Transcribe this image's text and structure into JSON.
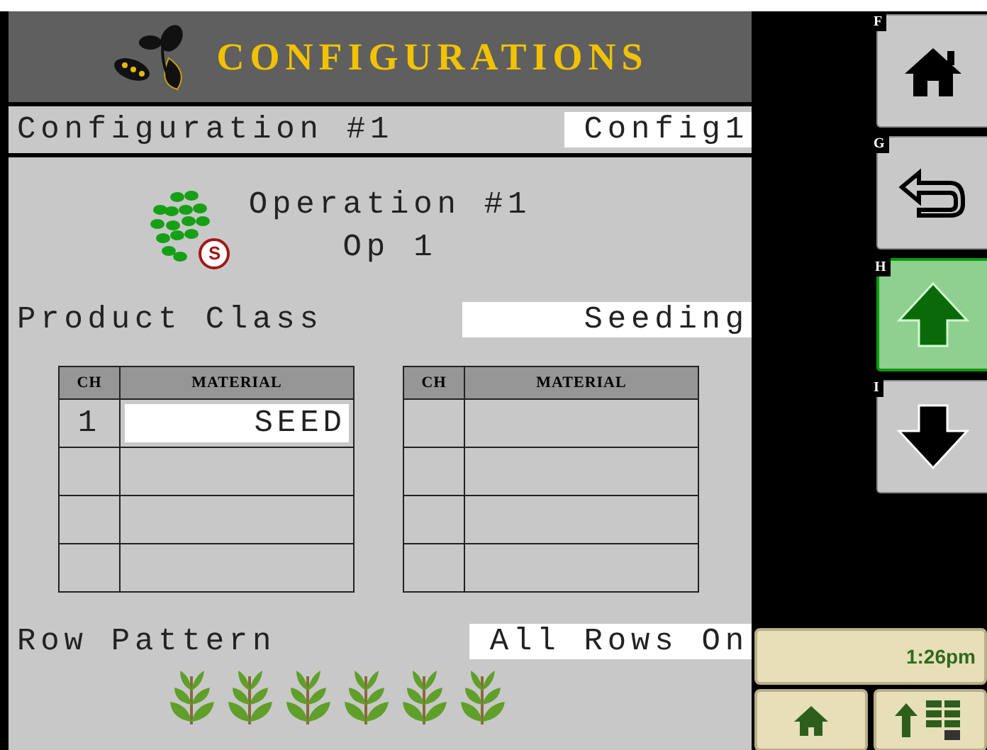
{
  "title": "CONFIGURATIONS",
  "configuration": {
    "label": "Configuration #1",
    "value": "Config1"
  },
  "operation": {
    "label": "Operation #1",
    "value": "Op 1",
    "badge": "S"
  },
  "product_class": {
    "label": "Product Class",
    "value": "Seeding"
  },
  "tables": [
    {
      "columns": [
        "CH",
        "MATERIAL"
      ],
      "rows": [
        {
          "ch": "1",
          "material": "SEED"
        },
        {},
        {},
        {}
      ]
    },
    {
      "columns": [
        "CH",
        "MATERIAL"
      ],
      "rows": [
        {},
        {},
        {},
        {}
      ]
    }
  ],
  "row_pattern": {
    "label": "Row Pattern",
    "value": "All Rows On"
  },
  "row_units": [
    {
      "on": true
    },
    {
      "on": true
    },
    {
      "on": true
    },
    {
      "on": true
    },
    {
      "on": true
    },
    {
      "on": true
    }
  ],
  "softkeys": [
    {
      "key": "F",
      "kind": "home",
      "selected": false
    },
    {
      "key": "G",
      "kind": "back",
      "selected": false
    },
    {
      "key": "H",
      "kind": "up",
      "selected": true
    },
    {
      "key": "I",
      "kind": "down",
      "selected": false
    }
  ],
  "status": {
    "time": "1:26pm"
  },
  "bottom_buttons": [
    {
      "kind": "home"
    },
    {
      "kind": "layout"
    }
  ]
}
